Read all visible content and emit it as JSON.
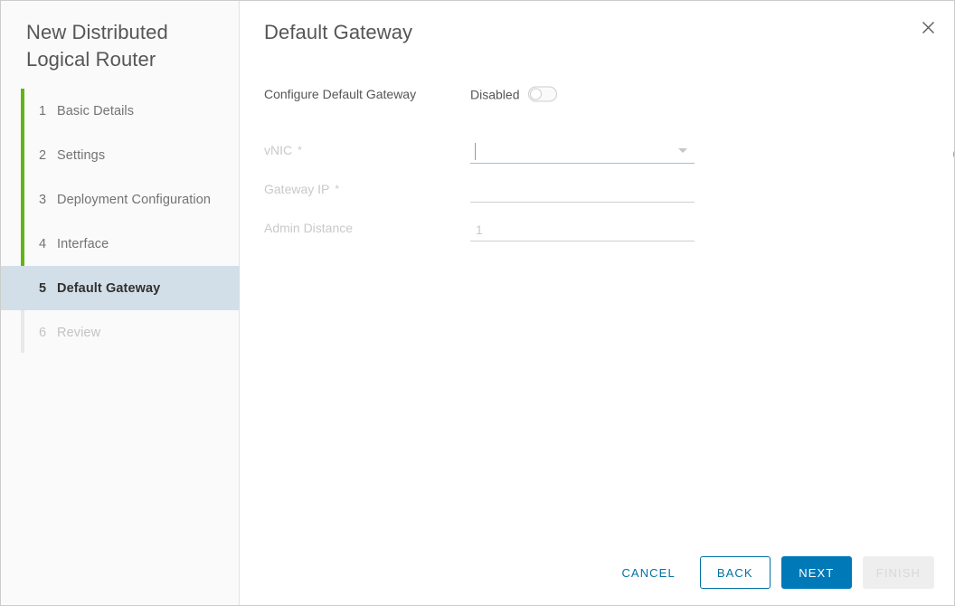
{
  "wizard": {
    "title": "New Distributed Logical Router",
    "steps": [
      {
        "num": "1",
        "label": "Basic Details",
        "state": "done"
      },
      {
        "num": "2",
        "label": "Settings",
        "state": "done"
      },
      {
        "num": "3",
        "label": "Deployment Configuration",
        "state": "done"
      },
      {
        "num": "4",
        "label": "Interface",
        "state": "done"
      },
      {
        "num": "5",
        "label": "Default Gateway",
        "state": "active"
      },
      {
        "num": "6",
        "label": "Review",
        "state": "upcoming"
      }
    ]
  },
  "page": {
    "title": "Default Gateway",
    "close_icon": "close-icon"
  },
  "form": {
    "configure_label": "Configure Default Gateway",
    "toggle_state_label": "Disabled",
    "toggle_enabled": false,
    "vnic": {
      "label": "vNIC",
      "required_marker": "*",
      "value": "",
      "placeholder": "",
      "info_icon": "info-icon"
    },
    "gateway_ip": {
      "label": "Gateway IP",
      "required_marker": "*",
      "value": "",
      "placeholder": ""
    },
    "admin_distance": {
      "label": "Admin Distance",
      "value": "1",
      "info_icon": "info-icon"
    }
  },
  "footer": {
    "cancel": "CANCEL",
    "back": "BACK",
    "next": "NEXT",
    "finish": "FINISH"
  },
  "colors": {
    "progress_green": "#60b515",
    "active_step_bg": "#d3dfe8",
    "primary_blue": "#0079b8",
    "link_blue": "#0072a3",
    "focus_underline": "#89cbdf"
  }
}
